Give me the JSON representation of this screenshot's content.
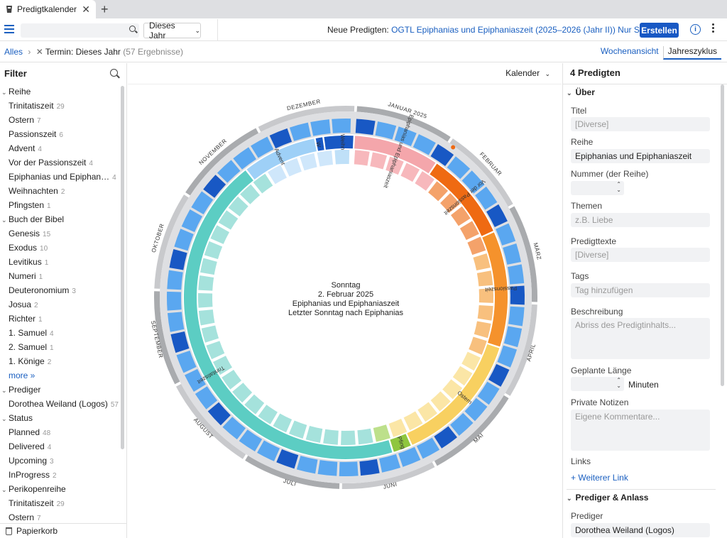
{
  "tab": {
    "title": "Predigtkalender"
  },
  "toolbar": {
    "search_placeholder": "",
    "year_filter": "Dieses Jahr",
    "new_label": "Neue Predigten:",
    "new_link": "OGTL Epiphanias und Epiphaniaszeit (2025–2026 (Jahr II)) Nur Sonntage",
    "create": "Erstellen"
  },
  "breadcrumb": {
    "all": "Alles",
    "filter": "Termin: Dieses Jahr",
    "count": "(57 Ergebnisse)"
  },
  "views": {
    "week": "Wochenansicht",
    "year": "Jahreszyklus"
  },
  "filter": {
    "title": "Filter",
    "rows": [
      {
        "t": "h",
        "label": "Reihe"
      },
      {
        "t": "i",
        "label": "Trinitatiszeit",
        "n": "29"
      },
      {
        "t": "i",
        "label": "Ostern",
        "n": "7"
      },
      {
        "t": "i",
        "label": "Passionszeit",
        "n": "6"
      },
      {
        "t": "i",
        "label": "Advent",
        "n": "4"
      },
      {
        "t": "i",
        "label": "Vor der Passionszeit",
        "n": "4"
      },
      {
        "t": "i",
        "label": "Epiphanias und Epiphan…",
        "n": "4"
      },
      {
        "t": "i",
        "label": "Weihnachten",
        "n": "2"
      },
      {
        "t": "i",
        "label": "Pfingsten",
        "n": "1"
      },
      {
        "t": "h",
        "label": "Buch der Bibel"
      },
      {
        "t": "i",
        "label": "Genesis",
        "n": "15"
      },
      {
        "t": "i",
        "label": "Exodus",
        "n": "10"
      },
      {
        "t": "i",
        "label": "Levitikus",
        "n": "1"
      },
      {
        "t": "i",
        "label": "Numeri",
        "n": "1"
      },
      {
        "t": "i",
        "label": "Deuteronomium",
        "n": "3"
      },
      {
        "t": "i",
        "label": "Josua",
        "n": "2"
      },
      {
        "t": "i",
        "label": "Richter",
        "n": "1"
      },
      {
        "t": "i",
        "label": "1. Samuel",
        "n": "4"
      },
      {
        "t": "i",
        "label": "2. Samuel",
        "n": "1"
      },
      {
        "t": "i",
        "label": "1. Könige",
        "n": "2"
      },
      {
        "t": "m",
        "label": "more »"
      },
      {
        "t": "h",
        "label": "Prediger"
      },
      {
        "t": "i",
        "label": "Dorothea Weiland (Logos)",
        "n": "57"
      },
      {
        "t": "h",
        "label": "Status"
      },
      {
        "t": "i",
        "label": "Planned",
        "n": "48"
      },
      {
        "t": "i",
        "label": "Delivered",
        "n": "4"
      },
      {
        "t": "i",
        "label": "Upcoming",
        "n": "3"
      },
      {
        "t": "i",
        "label": "InProgress",
        "n": "2"
      },
      {
        "t": "h",
        "label": "Perikopenreihe"
      },
      {
        "t": "i",
        "label": "Trinitatiszeit",
        "n": "29"
      },
      {
        "t": "i",
        "label": "Ostern",
        "n": "7"
      }
    ],
    "trash": "Papierkorb"
  },
  "calendar": {
    "view_select": "Kalender",
    "center": {
      "line1": "Sonntag",
      "line2": "2. Februar 2025",
      "line3": "Epiphanias und Epiphaniaszeit",
      "line4": "Letzter Sonntag nach Epiphanias"
    },
    "months": [
      "JANUAR 2025",
      "FEBRUAR",
      "MÄRZ",
      "APRIL",
      "MAI",
      "JUNI",
      "JULI",
      "AUGUST",
      "SEPTEMBER",
      "OKTOBER",
      "NOVEMBER",
      "DEZEMBER"
    ],
    "seasons": [
      {
        "label": "Weihn",
        "color": "#1858c4"
      },
      {
        "label": "Epiphanias und Epiphaniaszeit",
        "color": "#e9646d"
      },
      {
        "label": "Vor der Passionszeit",
        "color": "#ef6a12"
      },
      {
        "label": "Passionszeit",
        "color": "#f5922c"
      },
      {
        "label": "Ostern",
        "color": "#f8d060"
      },
      {
        "label": "Pfing",
        "color": "#8fc63f"
      },
      {
        "label": "Trinitatiszeit",
        "color": "#5ccdc3"
      },
      {
        "label": "Advent",
        "color": "#9ed0f7"
      },
      {
        "label": "W",
        "color": "#1858c4"
      }
    ]
  },
  "detail": {
    "title": "4 Predigten",
    "section_about": "Über",
    "label_title": "Titel",
    "title_value": "[Diverse]",
    "label_series": "Reihe",
    "series_value": "Epiphanias und Epiphaniaszeit",
    "label_number": "Nummer (der Reihe)",
    "label_topics": "Themen",
    "topics_placeholder": "z.B. Liebe",
    "label_texts": "Predigttexte",
    "texts_value": "[Diverse]",
    "label_tags": "Tags",
    "tags_placeholder": "Tag hinzufügen",
    "label_desc": "Beschreibung",
    "desc_placeholder": "Abriss des Predigtinhalts...",
    "label_length": "Geplante Länge",
    "length_unit": "Minuten",
    "label_notes": "Private Notizen",
    "notes_placeholder": "Eigene Kommentare...",
    "label_links": "Links",
    "add_link": "+ Weiterer Link",
    "section_preacher": "Prediger & Anlass",
    "label_preacher": "Prediger",
    "preacher_value": "Dorothea Weiland (Logos)"
  }
}
